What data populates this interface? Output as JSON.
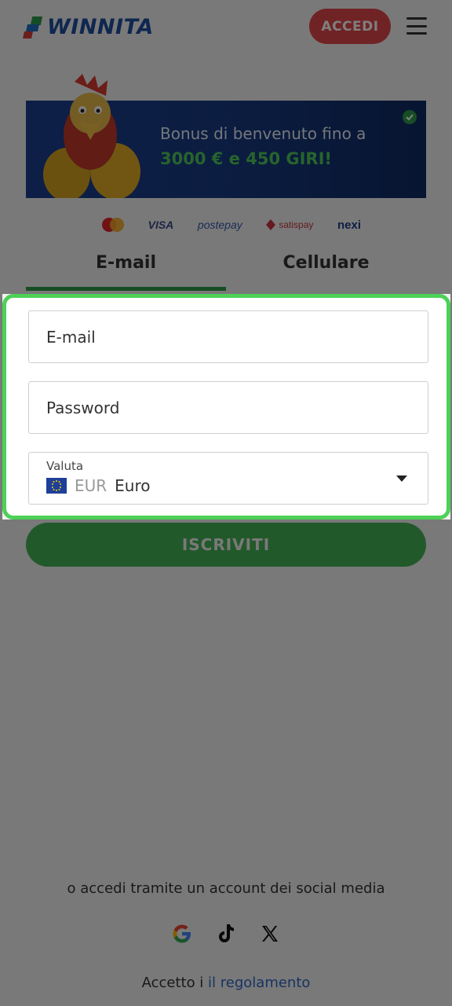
{
  "header": {
    "logo_text": "WINNITA",
    "login_label": "ACCEDI",
    "menu_icon": "hamburger-menu-icon"
  },
  "banner": {
    "line1": "Bonus di benvenuto fino a",
    "line2": "3000 € e 450 GIRI!",
    "check_icon": "checkmark-icon"
  },
  "payments": {
    "visa": "VISA",
    "postepay": "postepay",
    "satispay": "satispay",
    "nexi": "nexi"
  },
  "tabs": [
    {
      "label": "E-mail",
      "active": true
    },
    {
      "label": "Cellulare",
      "active": false
    }
  ],
  "form": {
    "email_placeholder": "E-mail",
    "password_placeholder": "Password",
    "currency_label": "Valuta",
    "currency_code": "EUR",
    "currency_name": "Euro"
  },
  "submit_label": "ISCRIVITI",
  "social": {
    "text": "o accedi tramite un account dei social media",
    "icons": [
      "google-icon",
      "tiktok-icon",
      "x-icon"
    ]
  },
  "rules": {
    "prefix": "Accetto i",
    "link": "il regolamento"
  },
  "colors": {
    "accent_green": "#4dd157",
    "login_red": "#e0474a",
    "brand_blue": "#1f4fa0"
  }
}
